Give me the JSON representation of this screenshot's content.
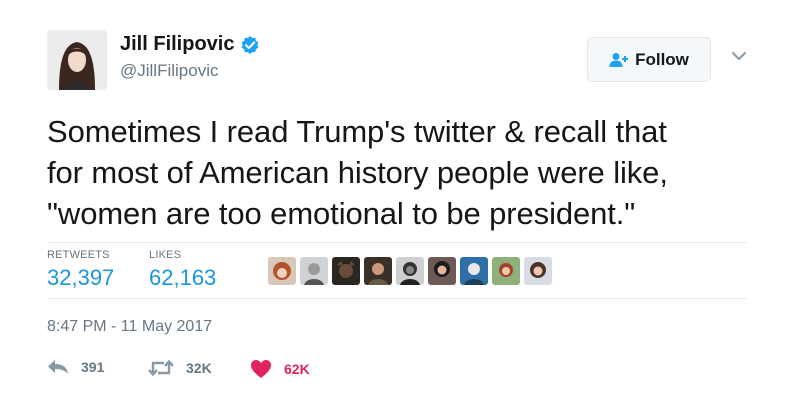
{
  "author": {
    "name": "Jill Filipovic",
    "handle": "@JillFilipovic",
    "verified": true
  },
  "follow_button": {
    "label": "Follow",
    "icon": "add-user-icon"
  },
  "tweet": {
    "lines": [
      "Sometimes I read Trump's twitter & recall that",
      "for most of American history people were like,",
      "\"women are too emotional to be president.\""
    ]
  },
  "stats": {
    "retweets_label": "RETWEETS",
    "retweets_value": "32,397",
    "likes_label": "LIKES",
    "likes_value": "62,163"
  },
  "likers_count": 9,
  "timestamp": "8:47 PM - 11 May 2017",
  "actions": {
    "reply_count": "391",
    "retweet_count": "32K",
    "like_count": "62K"
  },
  "colors": {
    "link_blue": "#1b95e0",
    "verified_blue": "#1da1f2",
    "like_red": "#e0245e",
    "muted": "#657786"
  }
}
